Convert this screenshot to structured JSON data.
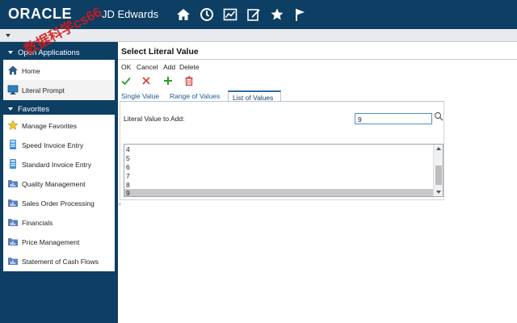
{
  "header": {
    "brand": "ORACLE",
    "product": "JD Edwards",
    "icons": [
      "home-icon",
      "recent-icon",
      "chart-icon",
      "edit-icon",
      "star-icon",
      "flag-icon"
    ]
  },
  "sidebar": {
    "open_apps_title": "Open Applications",
    "open_apps": [
      {
        "label": "Home",
        "icon": "home-icon"
      },
      {
        "label": "Literal Prompt",
        "icon": "monitor-icon"
      }
    ],
    "favorites_title": "Favorites",
    "favorites": [
      {
        "label": "Manage Favorites",
        "icon": "star-icon"
      },
      {
        "label": "Speed Invoice Entry",
        "icon": "calculator-icon"
      },
      {
        "label": "Standard Invoice Entry",
        "icon": "calculator-icon"
      },
      {
        "label": "Quality Management",
        "icon": "folder-chart-icon"
      },
      {
        "label": "Sales Order Processing",
        "icon": "folder-chart-icon"
      },
      {
        "label": "Financials",
        "icon": "folder-chart-icon"
      },
      {
        "label": "Price Management",
        "icon": "folder-chart-icon"
      },
      {
        "label": "Statement of Cash Flows",
        "icon": "folder-chart-icon"
      }
    ]
  },
  "main": {
    "title": "Select Literal Value",
    "menu": {
      "ok": "OK",
      "cancel": "Cancel",
      "add": "Add",
      "delete": "Delete"
    },
    "tabs": [
      "Single Value",
      "Range of Values",
      "List of Values"
    ],
    "active_tab": "List of Values",
    "literal_label": "Literal Value to Add:",
    "literal_value": "9",
    "list_items": [
      "4",
      "5",
      "6",
      "7",
      "8",
      "9"
    ],
    "selected_item": "9"
  },
  "watermark": "数据科学cs66",
  "colors": {
    "header_bg": "#0d3e63",
    "accent": "#2f6ea5",
    "ok_green": "#2a9d2a",
    "cancel_red": "#d83a3a",
    "delete_red": "#d83a3a"
  }
}
